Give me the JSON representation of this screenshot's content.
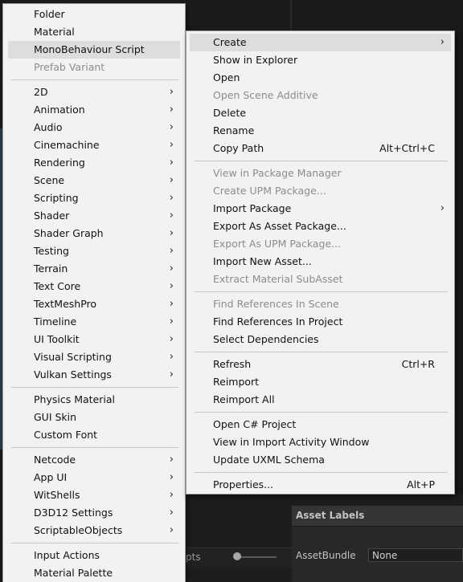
{
  "background": {
    "asset_labels": "Asset Labels",
    "asset_bundle": "AssetBundle",
    "asset_bundle_value": "None",
    "pts_fragment": "pts"
  },
  "create_menu": {
    "items": [
      {
        "label": "Folder",
        "enabled": true
      },
      {
        "label": "Material",
        "enabled": true
      },
      {
        "label": "MonoBehaviour Script",
        "enabled": true,
        "highlighted": true
      },
      {
        "label": "Prefab Variant",
        "enabled": false
      },
      {
        "separator": true
      },
      {
        "label": "2D",
        "submenu": true
      },
      {
        "label": "Animation",
        "submenu": true
      },
      {
        "label": "Audio",
        "submenu": true
      },
      {
        "label": "Cinemachine",
        "submenu": true
      },
      {
        "label": "Rendering",
        "submenu": true
      },
      {
        "label": "Scene",
        "submenu": true
      },
      {
        "label": "Scripting",
        "submenu": true
      },
      {
        "label": "Shader",
        "submenu": true
      },
      {
        "label": "Shader Graph",
        "submenu": true
      },
      {
        "label": "Testing",
        "submenu": true
      },
      {
        "label": "Terrain",
        "submenu": true
      },
      {
        "label": "Text Core",
        "submenu": true
      },
      {
        "label": "TextMeshPro",
        "submenu": true
      },
      {
        "label": "Timeline",
        "submenu": true
      },
      {
        "label": "UI Toolkit",
        "submenu": true
      },
      {
        "label": "Visual Scripting",
        "submenu": true
      },
      {
        "label": "Vulkan Settings",
        "submenu": true
      },
      {
        "separator": true
      },
      {
        "label": "Physics Material"
      },
      {
        "label": "GUI Skin"
      },
      {
        "label": "Custom Font"
      },
      {
        "separator": true
      },
      {
        "label": "Netcode",
        "submenu": true
      },
      {
        "label": "App UI",
        "submenu": true
      },
      {
        "label": "WitShells",
        "submenu": true
      },
      {
        "label": "D3D12 Settings",
        "submenu": true
      },
      {
        "label": "ScriptableObjects",
        "submenu": true
      },
      {
        "separator": true
      },
      {
        "label": "Input Actions"
      },
      {
        "label": "Material Palette"
      }
    ]
  },
  "context_menu": {
    "items": [
      {
        "label": "Create",
        "submenu": true,
        "highlighted": true
      },
      {
        "label": "Show in Explorer"
      },
      {
        "label": "Open"
      },
      {
        "label": "Open Scene Additive",
        "enabled": false
      },
      {
        "label": "Delete"
      },
      {
        "label": "Rename"
      },
      {
        "label": "Copy Path",
        "shortcut": "Alt+Ctrl+C"
      },
      {
        "separator": true
      },
      {
        "label": "View in Package Manager",
        "enabled": false
      },
      {
        "label": "Create UPM Package...",
        "enabled": false
      },
      {
        "label": "Import Package",
        "submenu": true
      },
      {
        "label": "Export As Asset Package..."
      },
      {
        "label": "Export As UPM Package...",
        "enabled": false
      },
      {
        "label": "Import New Asset..."
      },
      {
        "label": "Extract Material SubAsset",
        "enabled": false
      },
      {
        "separator": true
      },
      {
        "label": "Find References In Scene",
        "enabled": false
      },
      {
        "label": "Find References In Project"
      },
      {
        "label": "Select Dependencies"
      },
      {
        "separator": true
      },
      {
        "label": "Refresh",
        "shortcut": "Ctrl+R"
      },
      {
        "label": "Reimport"
      },
      {
        "label": "Reimport All"
      },
      {
        "separator": true
      },
      {
        "label": "Open C# Project"
      },
      {
        "label": "View in Import Activity Window"
      },
      {
        "label": "Update UXML Schema"
      },
      {
        "separator": true
      },
      {
        "label": "Properties...",
        "shortcut": "Alt+P"
      }
    ]
  }
}
